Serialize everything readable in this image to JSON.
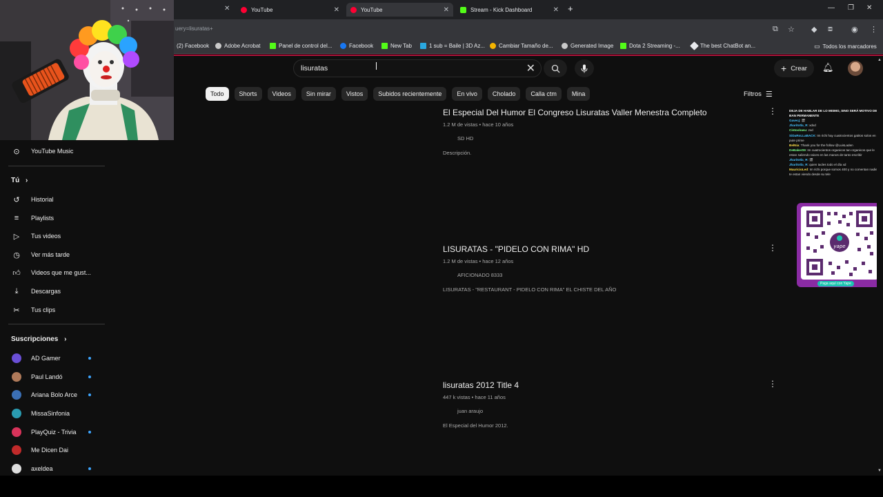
{
  "browser": {
    "tabs": [
      {
        "label": "YouTube"
      },
      {
        "label": "YouTube"
      },
      {
        "label": "Stream - Kick Dashboard"
      }
    ],
    "url": "uery=lisuratas+",
    "bookmarks": [
      "(2) Facebook",
      "Adobe Acrobat",
      "Panel de control del...",
      "Facebook",
      "New Tab",
      "1 sub = Baile | 3D Az...",
      "Cambiar Tamaño de...",
      "Generated Image",
      "Dota 2 Streaming -...",
      "The best ChatBot an..."
    ],
    "bookmarks_folder": "Todos los marcadores"
  },
  "header": {
    "search_query": "lisuratas",
    "create_label": "Crear"
  },
  "chips": [
    "Todo",
    "Shorts",
    "Videos",
    "Sin mirar",
    "Vistos",
    "Subidos recientemente",
    "En vivo",
    "Cholado",
    "Calla ctm",
    "Mina"
  ],
  "filters_label": "Filtros",
  "sidebar": {
    "top_items": [
      {
        "label": "YouTube Music",
        "icon": "youtube-music-icon"
      }
    ],
    "you_heading": "Tú",
    "you_items": [
      {
        "label": "Historial",
        "icon": "history-icon"
      },
      {
        "label": "Playlists",
        "icon": "playlist-icon"
      },
      {
        "label": "Tus videos",
        "icon": "your-videos-icon"
      },
      {
        "label": "Ver más tarde",
        "icon": "watch-later-icon"
      },
      {
        "label": "Videos que me gust...",
        "icon": "like-icon"
      },
      {
        "label": "Descargas",
        "icon": "download-icon"
      },
      {
        "label": "Tus clips",
        "icon": "scissors-icon"
      }
    ],
    "subs_heading": "Suscripciones",
    "subscriptions": [
      {
        "label": "AD Gamer",
        "dot": true,
        "color": "#6a4fd6"
      },
      {
        "label": "Paul Landó",
        "dot": true,
        "color": "#b07a5a"
      },
      {
        "label": "Ariana Bolo Arce",
        "dot": true,
        "color": "#3b6fb5"
      },
      {
        "label": "MissaSinfonia",
        "dot": false,
        "color": "#2a9bb0"
      },
      {
        "label": "PlayQuiz - Trivia",
        "dot": true,
        "color": "#d8335a"
      },
      {
        "label": "Me Dicen Dai",
        "dot": false,
        "color": "#c02a2a"
      },
      {
        "label": "axeldea",
        "dot": true,
        "color": "#dddddd"
      }
    ]
  },
  "results": [
    {
      "title": "El Especial Del Humor El Congreso Lisuratas Valler Menestra Completo",
      "meta": "1.2 M de vistas • hace 10 años",
      "channel": "SD HD",
      "description": "Descripción."
    },
    {
      "title": "LISURATAS - \"PIDELO CON RIMA\" HD",
      "meta": "1.2 M de vistas • hace 12 años",
      "channel": "AFICIONADO 8333",
      "description": "LISURATAS - \"RESTAURANT - PIDELO CON RIMA\" EL CHISTE DEL AÑO"
    },
    {
      "title": "lisuratas 2012 Title 4",
      "meta": "447 k vistas • hace 11 años",
      "channel": "juan araujo",
      "description": "El Especial del Humor 2012."
    }
  ],
  "overlay": {
    "chat_header": "DEJA DE HABLAR DE LO MISMO, SINO SERÁ MOTIVO DE BAN PERMANENTE",
    "chat": [
      {
        "user": "Gavecj",
        "text": ": 🎬"
      },
      {
        "user": "Jharitotla_R",
        "text": ": xdxd"
      },
      {
        "user": "Cintooluwu",
        "text": ": zxd"
      },
      {
        "user": "SiDaRoLLaBACK",
        "text": ": Im richi hay cuatrocientos gatitos solos en el pute prime"
      },
      {
        "user": "BelNia",
        "text": ": Thank you for the follow @LuisLaden"
      },
      {
        "user": "DeBaker09",
        "text": ": Im cuatrocientos organicos tan organicos que le estan saliendo raices en las manos de tanto escribir"
      },
      {
        "user": "Jharitotla_R",
        "text": ": 🎬"
      },
      {
        "user": "Jharitotla_R",
        "text": ": quien tacles todo el día xd"
      },
      {
        "user": "MauricioLed",
        "text": ": Im richi porque somos 400 y no comentan nadie o te estan viendo desde su tele"
      }
    ],
    "qr_label": "Paga aquí con Yape",
    "qr_brand": "yape"
  }
}
